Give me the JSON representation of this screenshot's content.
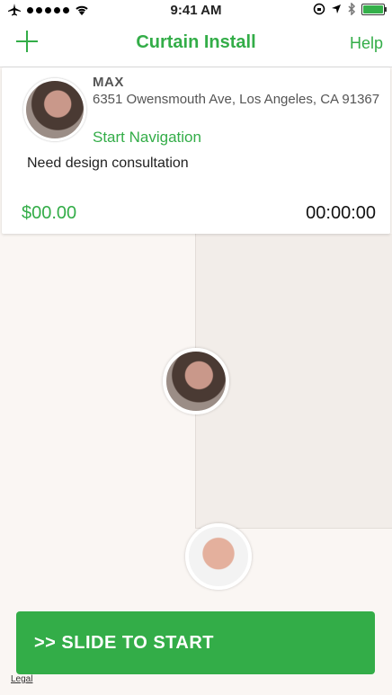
{
  "status_bar": {
    "time": "9:41 AM",
    "airplane_icon": "airplane-icon",
    "wifi_icon": "wifi-icon",
    "icons_right": [
      "rotation-lock-icon",
      "location-icon",
      "bluetooth-icon",
      "battery-icon"
    ],
    "battery_level": 1.0
  },
  "nav": {
    "title": "Curtain Install",
    "help_label": "Help",
    "add_icon": "plus-icon"
  },
  "customer": {
    "name": "MAX",
    "address": "6351 Owensmouth Ave, Los Angeles, CA 91367",
    "start_navigation_label": "Start Navigation",
    "note": "Need design consultation",
    "price": "$00.00",
    "timer": "00:00:00"
  },
  "action": {
    "slide_label": ">> SLIDE TO START",
    "legal_label": "Legal"
  },
  "colors": {
    "accent": "#33ad48",
    "map_bg": "#faf6f3",
    "map_block": "#f2ede9"
  }
}
